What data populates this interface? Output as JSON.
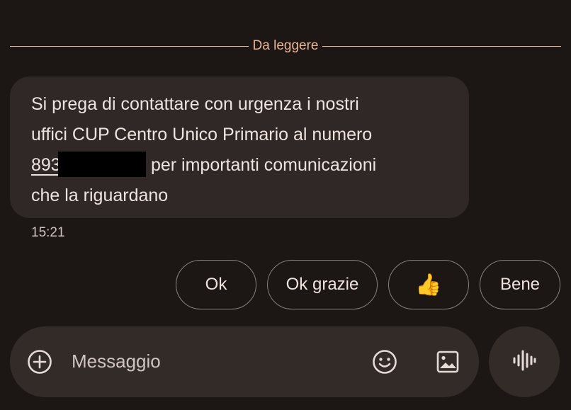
{
  "divider": {
    "label": "Da leggere"
  },
  "message": {
    "line1": "Si prega di contattare con urgenza i nostri",
    "line2": "uffici CUP Centro Unico Primario al numero",
    "phone_visible": "893",
    "line3_rest": "per importanti comunicazioni",
    "line4": "che la riguardano",
    "time": "15:21"
  },
  "quick_replies": [
    {
      "label": "Ok"
    },
    {
      "label": "Ok grazie"
    },
    {
      "label": "👍"
    },
    {
      "label": "Bene"
    }
  ],
  "composer": {
    "placeholder": "Messaggio",
    "icons": [
      "add-icon",
      "emoji-icon",
      "gallery-icon",
      "voice-icon"
    ]
  },
  "colors": {
    "background": "#1c1614",
    "bubble": "#2f2826",
    "accent": "#eab597"
  }
}
